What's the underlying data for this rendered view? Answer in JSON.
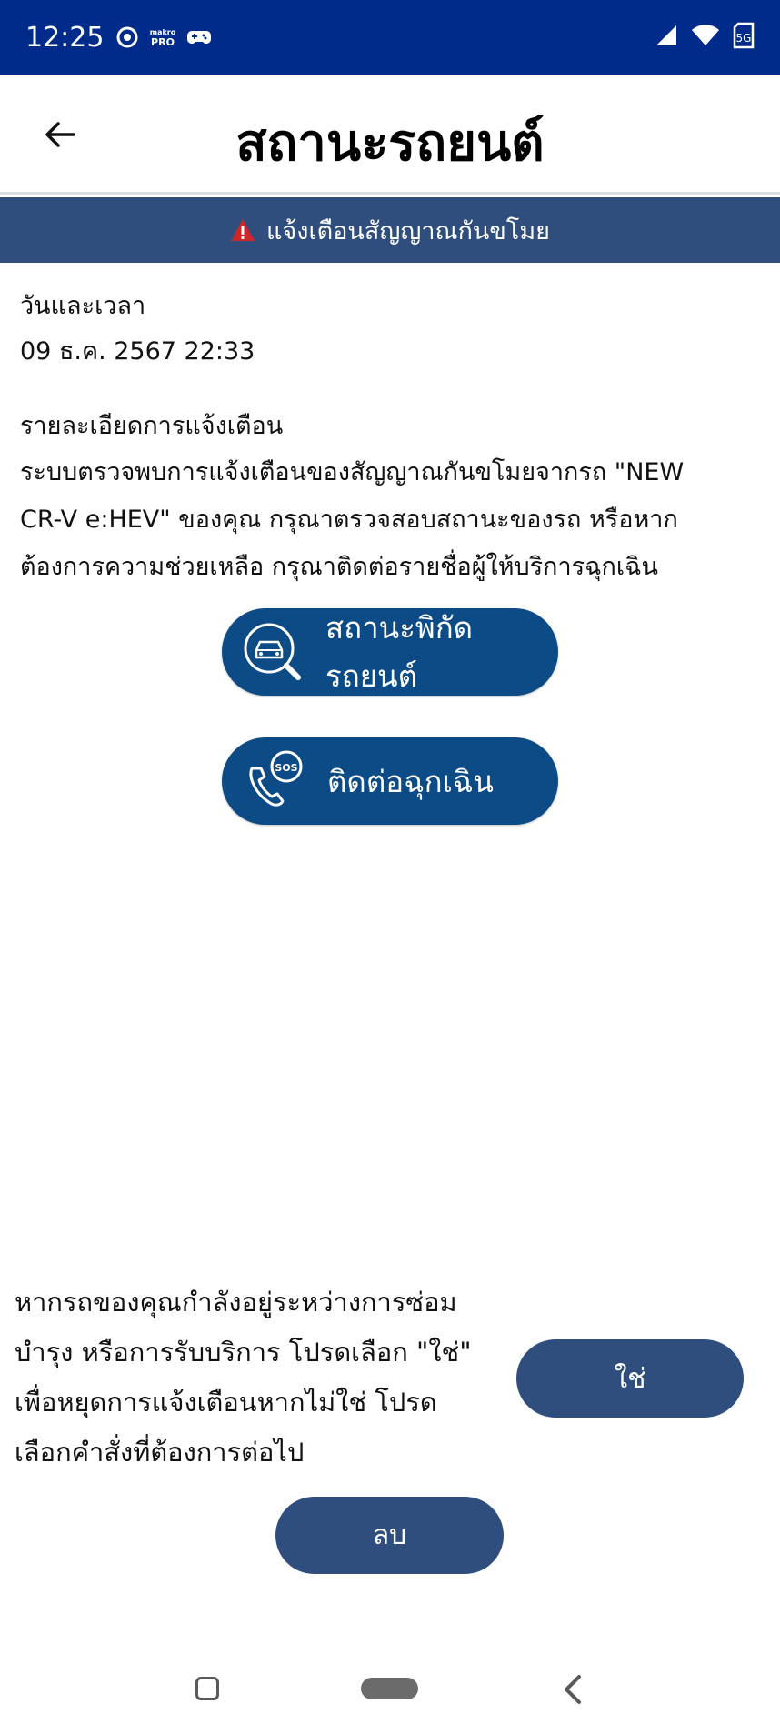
{
  "status_bar": {
    "time": "12:25",
    "app_badge": "makro\nPRO",
    "icons": [
      "chrome-icon",
      "makro-pro-icon",
      "game-controller-icon",
      "signal-icon",
      "wifi-icon",
      "sim-5g-icon"
    ],
    "sim_label": "5G"
  },
  "header": {
    "title": "สถานะรถยนต์"
  },
  "alert_banner": {
    "text": "แจ้งเตือนสัญญาณกันขโมย",
    "accent_color": "#d0262a"
  },
  "details": {
    "datetime_label": "วันและเวลา",
    "datetime_value": "09 ธ.ค. 2567 22:33",
    "detail_title": "รายละเอียดการแจ้งเตือน",
    "detail_lines": [
      "ระบบตรวจพบการแจ้งเตือนของสัญญาณกันขโมยจากรถ \"NEW",
      "CR-V e:HEV\" ของคุณ กรุณาตรวจสอบสถานะของรถ หรือหาก",
      "ต้องการความช่วยเหลือ กรุณาติดต่อรายชื่อผู้ให้บริการฉุกเฉิน"
    ]
  },
  "actions": {
    "location_label": "สถานะพิกัดรถยนต์",
    "emergency_label": "ติดต่อฉุกเฉิน",
    "sos_text": "SOS"
  },
  "maintenance": {
    "lines": [
      "หากรถของคุณกำลังอยู่ระหว่างการซ่อม",
      "บำรุง หรือการรับบริการ โปรดเลือก \"ใช่\"",
      "เพื่อหยุดการแจ้งเตือนหากไม่ใช่ โปรด",
      "เลือกคำสั่งที่ต้องการต่อไป"
    ],
    "yes_label": "ใช่",
    "delete_label": "ลบ"
  },
  "colors": {
    "status_bar": "#002b8a",
    "banner": "#2f4e7e",
    "action_button": "#0d4b87",
    "secondary_button": "#2f4e7e"
  }
}
